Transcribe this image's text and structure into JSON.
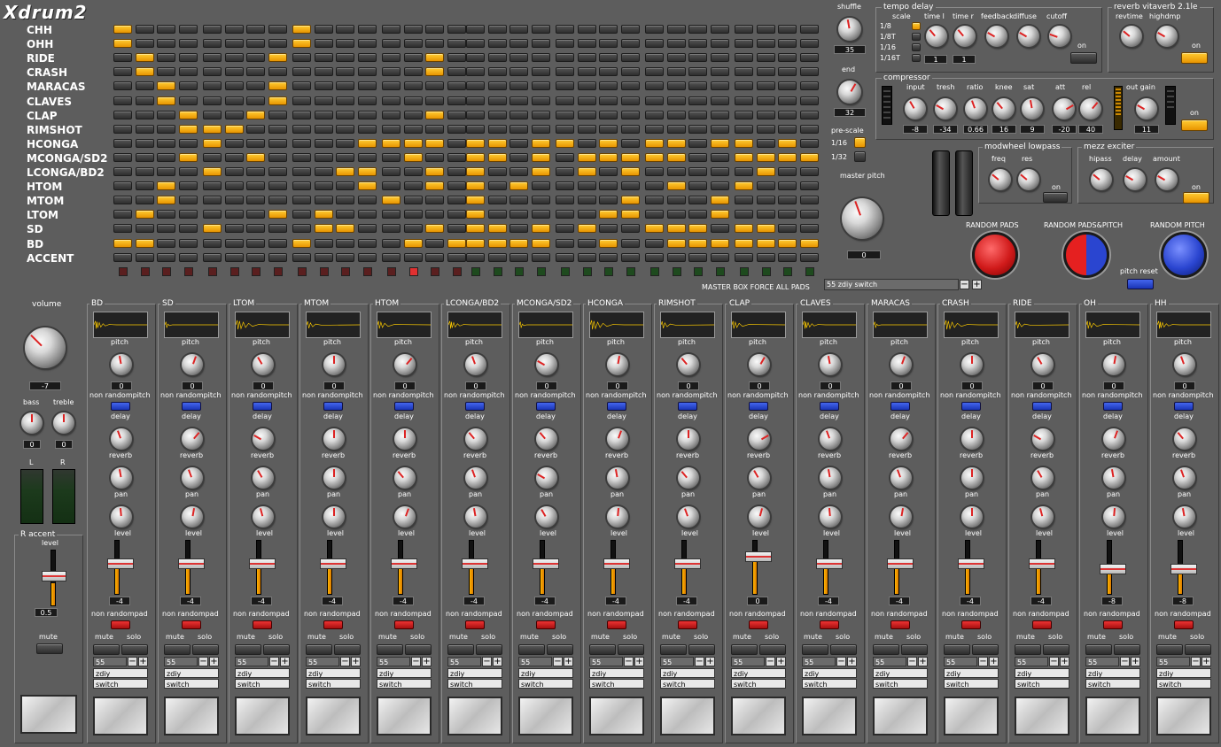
{
  "app": {
    "title": "Xdrum2"
  },
  "pattern": {
    "instruments": [
      "CHH",
      "OHH",
      "RIDE",
      "CRASH",
      "MARACAS",
      "CLAVES",
      "CLAP",
      "RIMSHOT",
      "HCONGA",
      "MCONGA/SD2",
      "LCONGA/BD2",
      "HTOM",
      "MTOM",
      "LTOM",
      "SD",
      "BD",
      "ACCENT"
    ],
    "steps": [
      "1000000010000000000000000000000000000000",
      "1000000010000000000000000000000000000000",
      "0100000100000010000000000000000000000000",
      "0100000000000010000000000000000000000000",
      "0010000100000000000000000000000000000000",
      "0010000100000000000000000000000000000000",
      "0001001000000010000000000000000000000000",
      "0001110000000000000000000000000000000000",
      "0000100000011110110110101101101011000111",
      "0001001000000100110101111100111100001101",
      "0000100000110010100101010000010001010101",
      "0010000000010010101000000100100000100001",
      "0010000000001000100000010001000010000001",
      "0100000101000000100000110001000001000001",
      "0000100001100010110101001110110011100101",
      "1100000010000101111100100111111100100111",
      "0000000000000000000000000000000000000000"
    ],
    "led_colors": [
      "#5a1f1f",
      "#5a1f1f",
      "#5a1f1f",
      "#5a1f1f",
      "#5a1f1f",
      "#5a1f1f",
      "#5a1f1f",
      "#5a1f1f",
      "#5a1f1f",
      "#5a1f1f",
      "#5a1f1f",
      "#5a1f1f",
      "#5a1f1f",
      "#e03030",
      "#5a1f1f",
      "#5a1f1f",
      "#1e4a1e",
      "#1e4a1e",
      "#1e4a1e",
      "#1e4a1e",
      "#1e4a1e",
      "#1e4a1e",
      "#1e4a1e",
      "#1e4a1e",
      "#1e4a1e",
      "#1e4a1e",
      "#1e4a1e",
      "#1e4a1e",
      "#1e4a1e",
      "#1e4a1e",
      "#1e4a1e",
      "#1e4a1e"
    ]
  },
  "global": {
    "shuffle_label": "shuffle",
    "shuffle_value": "35",
    "end_label": "end",
    "end_value": "32",
    "prescale_label": "pre-scale",
    "prescale_opts": [
      "1/16",
      "1/32"
    ],
    "master_pitch_label": "master pitch",
    "master_pitch_value": "0",
    "master_box_label": "MASTER BOX FORCE ALL PADS",
    "master_box_value": "55 zdiy switch",
    "random_pads": "RANDOM PADS",
    "random_pads_pitch": "RANDOM PADS&PITCH",
    "random_pitch": "RANDOM PITCH",
    "pitch_reset": "pitch reset"
  },
  "tempo_delay": {
    "title": "tempo delay",
    "scale": "scale",
    "scales": [
      "1/8",
      "1/8T",
      "1/16",
      "1/16T"
    ],
    "knobs": [
      "time l",
      "time r",
      "feedback",
      "diffuse",
      "cutoff"
    ],
    "time_l": "1",
    "time_r": "1",
    "on": "on"
  },
  "reverb": {
    "title": "reverb vitaverb 2.1le",
    "knobs": [
      "revtime",
      "highdmp"
    ],
    "on": "on"
  },
  "compressor": {
    "title": "compressor",
    "knobs": [
      "input",
      "tresh",
      "ratio",
      "knee",
      "sat",
      "att",
      "rel"
    ],
    "values": [
      "-8",
      "-34",
      "0.66",
      "16",
      "9",
      "-20",
      "40"
    ],
    "out_gain": "out gain",
    "out_gain_value": "11",
    "on": "on"
  },
  "modwheel": {
    "title": "modwheel lowpass",
    "knobs": [
      "freq",
      "res"
    ],
    "on": "on"
  },
  "exciter": {
    "title": "mezz exciter",
    "knobs": [
      "hipass",
      "delay",
      "amount"
    ],
    "on": "on"
  },
  "master": {
    "volume": "volume",
    "volume_value": "-7",
    "bass": "bass",
    "bass_value": "0",
    "treble": "treble",
    "treble_value": "0",
    "l": "L",
    "r": "R",
    "accent": "accent",
    "accent_level": "level",
    "accent_value": "0.5",
    "mute": "mute"
  },
  "channel_labels": {
    "pitch": "pitch",
    "nonrandompitch": "non randompitch",
    "delay": "delay",
    "reverb": "reverb",
    "pan": "pan",
    "level": "level",
    "nonrandompad": "non randompad",
    "mute": "mute",
    "solo": "solo",
    "minus": "−",
    "plus": "+"
  },
  "channels": [
    {
      "name": "BD",
      "pitch": "0",
      "level": "-4",
      "fader": 0.55,
      "num": "55",
      "k1": "zdiy",
      "k2": "switch"
    },
    {
      "name": "SD",
      "pitch": "0",
      "level": "-4",
      "fader": 0.55,
      "num": "55",
      "k1": "zdiy",
      "k2": "switch"
    },
    {
      "name": "LTOM",
      "pitch": "0",
      "level": "-4",
      "fader": 0.55,
      "num": "55",
      "k1": "zdiy",
      "k2": "switch"
    },
    {
      "name": "MTOM",
      "pitch": "0",
      "level": "-4",
      "fader": 0.55,
      "num": "55",
      "k1": "zdiy",
      "k2": "switch"
    },
    {
      "name": "HTOM",
      "pitch": "0",
      "level": "-4",
      "fader": 0.55,
      "num": "55",
      "k1": "zdiy",
      "k2": "switch"
    },
    {
      "name": "LCONGA/BD2",
      "pitch": "0",
      "level": "-4",
      "fader": 0.55,
      "num": "55",
      "k1": "zdiy",
      "k2": "switch"
    },
    {
      "name": "MCONGA/SD2",
      "pitch": "0",
      "level": "-4",
      "fader": 0.55,
      "num": "55",
      "k1": "zdiy",
      "k2": "switch"
    },
    {
      "name": "HCONGA",
      "pitch": "0",
      "level": "-4",
      "fader": 0.55,
      "num": "55",
      "k1": "zdiy",
      "k2": "switch"
    },
    {
      "name": "RIMSHOT",
      "pitch": "0",
      "level": "-4",
      "fader": 0.55,
      "num": "55",
      "k1": "zdiy",
      "k2": "switch"
    },
    {
      "name": "CLAP",
      "pitch": "0",
      "level": "0",
      "fader": 0.75,
      "num": "55",
      "k1": "zdiy",
      "k2": "switch"
    },
    {
      "name": "CLAVES",
      "pitch": "0",
      "level": "-4",
      "fader": 0.55,
      "num": "55",
      "k1": "zdiy",
      "k2": "switch"
    },
    {
      "name": "MARACAS",
      "pitch": "0",
      "level": "-4",
      "fader": 0.55,
      "num": "55",
      "k1": "zdiy",
      "k2": "switch"
    },
    {
      "name": "CRASH",
      "pitch": "0",
      "level": "-4",
      "fader": 0.55,
      "num": "55",
      "k1": "zdiy",
      "k2": "switch"
    },
    {
      "name": "RIDE",
      "pitch": "0",
      "level": "-4",
      "fader": 0.55,
      "num": "55",
      "k1": "zdiy",
      "k2": "switch"
    },
    {
      "name": "OH",
      "pitch": "0",
      "level": "-8",
      "fader": 0.4,
      "num": "55",
      "k1": "zdiy",
      "k2": "switch"
    },
    {
      "name": "HH",
      "pitch": "0",
      "level": "-8",
      "fader": 0.4,
      "num": "55",
      "k1": "zdiy",
      "k2": "switch"
    }
  ],
  "colors": {
    "step_on": "#f5a800",
    "accent_red": "#d22",
    "pad_blue": "#2a45d0",
    "pad_red": "#d01a1a"
  }
}
